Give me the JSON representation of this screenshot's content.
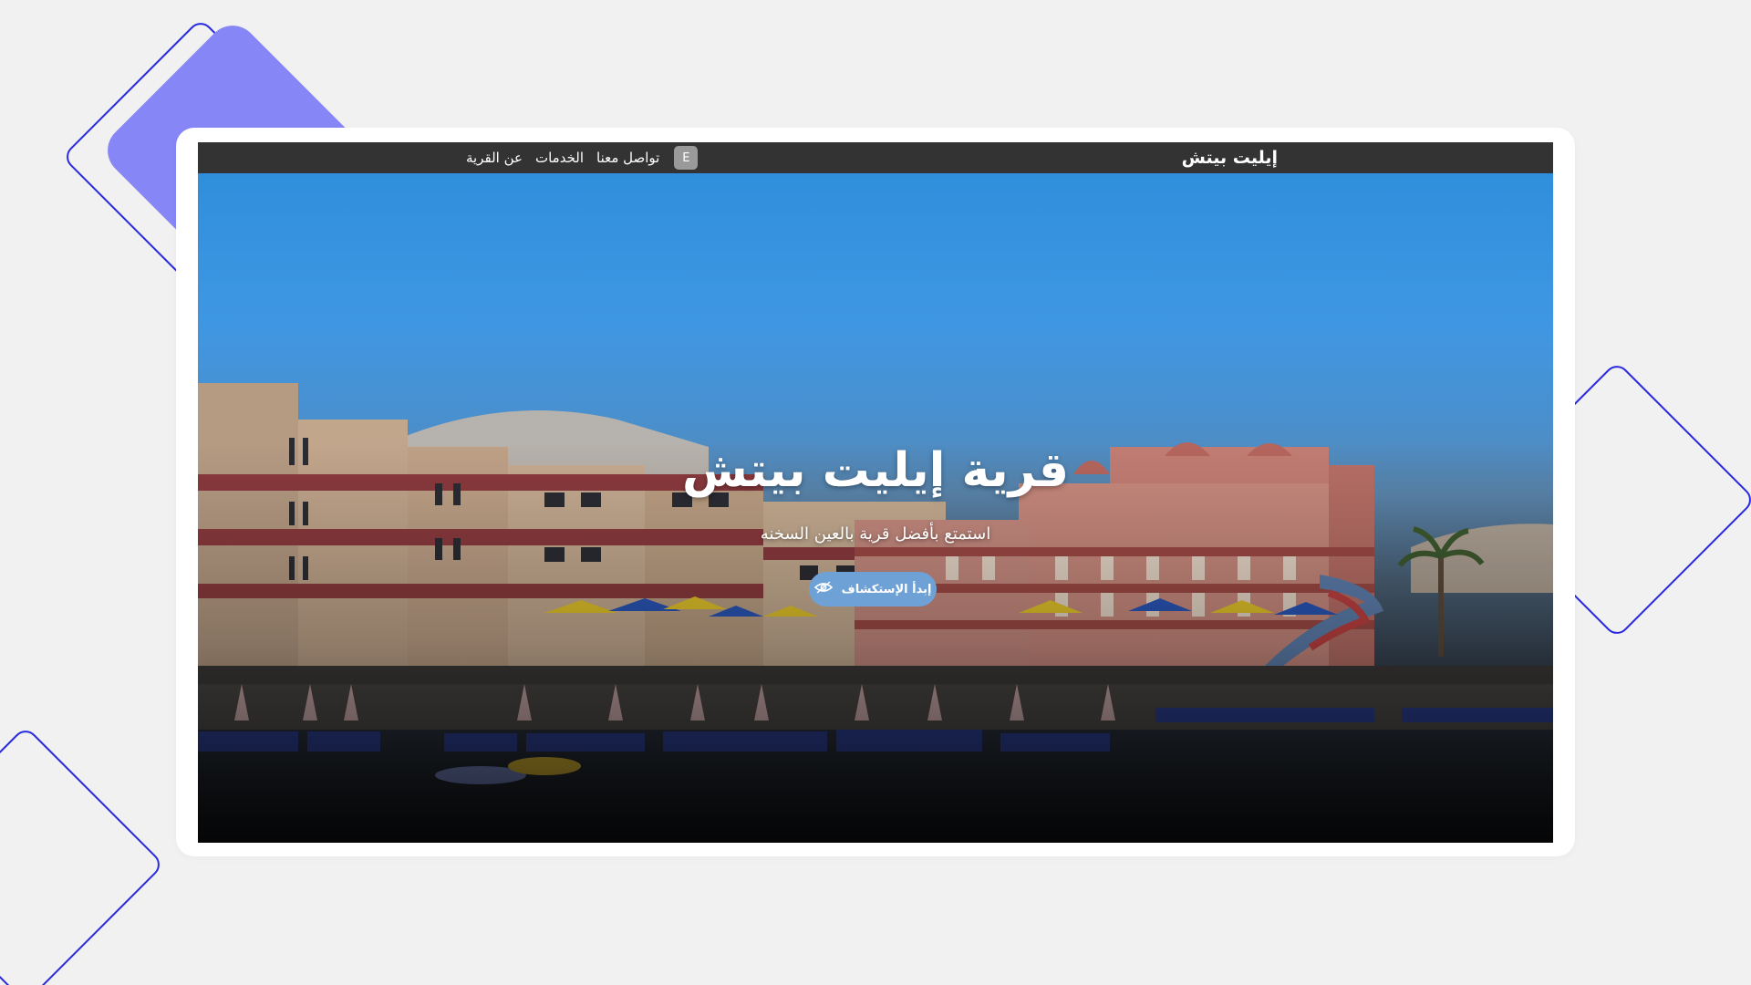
{
  "navbar": {
    "brand": "إيليت بيتش",
    "links": [
      {
        "label": "عن القرية"
      },
      {
        "label": "الخدمات"
      },
      {
        "label": "تواصل معنا"
      }
    ],
    "language_button": "E"
  },
  "hero": {
    "title": "قرية إيليت بيتش",
    "subtitle": "استمتع بأفضل قرية بالعين السخنه",
    "cta_label": "إبدأ الإستكشاف",
    "cta_icon": "eye-icon",
    "background": "photo of beach resort buildings with umbrellas under a blue sky"
  },
  "colors": {
    "page_background": "#f1f1f1",
    "navbar": "#333333",
    "accent_shape": "#8686f6",
    "outline_shape": "#2a2ae0",
    "cta": "#6ea2d6"
  }
}
